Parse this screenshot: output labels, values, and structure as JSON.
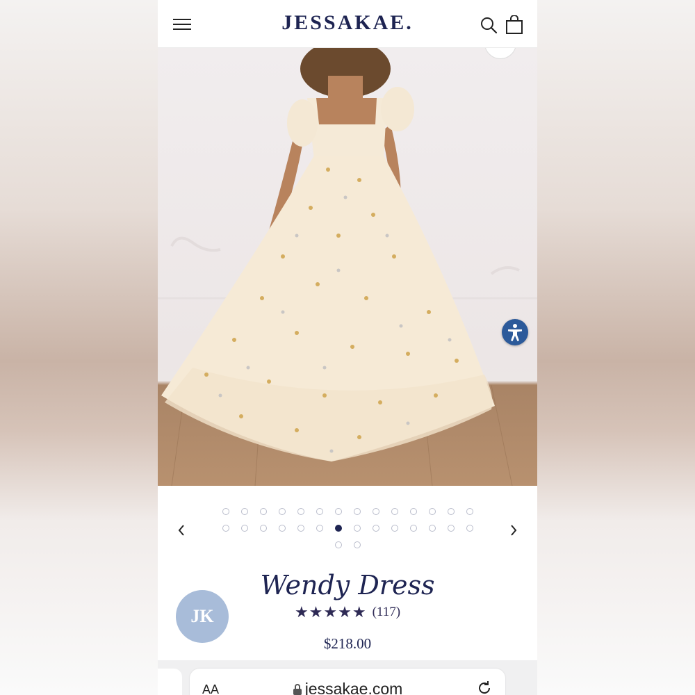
{
  "header": {
    "brand": "JESSAKAE.",
    "menu_icon": "hamburger-menu-icon",
    "search_icon": "search-icon",
    "cart_icon": "shopping-bag-icon"
  },
  "hero": {
    "accessibility_icon": "accessibility-icon"
  },
  "carousel": {
    "total_images": 30,
    "active_index": 20,
    "prev_icon": "chevron-left-icon",
    "next_icon": "chevron-right-icon"
  },
  "product": {
    "avatar_initials": "JK",
    "title": "Wendy Dress",
    "stars": "★★★★★",
    "rating_out_of_5": 5,
    "review_count": "(117)",
    "price": "$218.00"
  },
  "browser": {
    "text_size_label": "AA",
    "url": "jessakae.com",
    "lock_icon": "lock-icon",
    "reload_icon": "reload-icon"
  },
  "colors": {
    "brand_navy": "#1e2452",
    "accessibility_blue": "#2c5a9a",
    "avatar_blue": "#a8bcd9"
  }
}
